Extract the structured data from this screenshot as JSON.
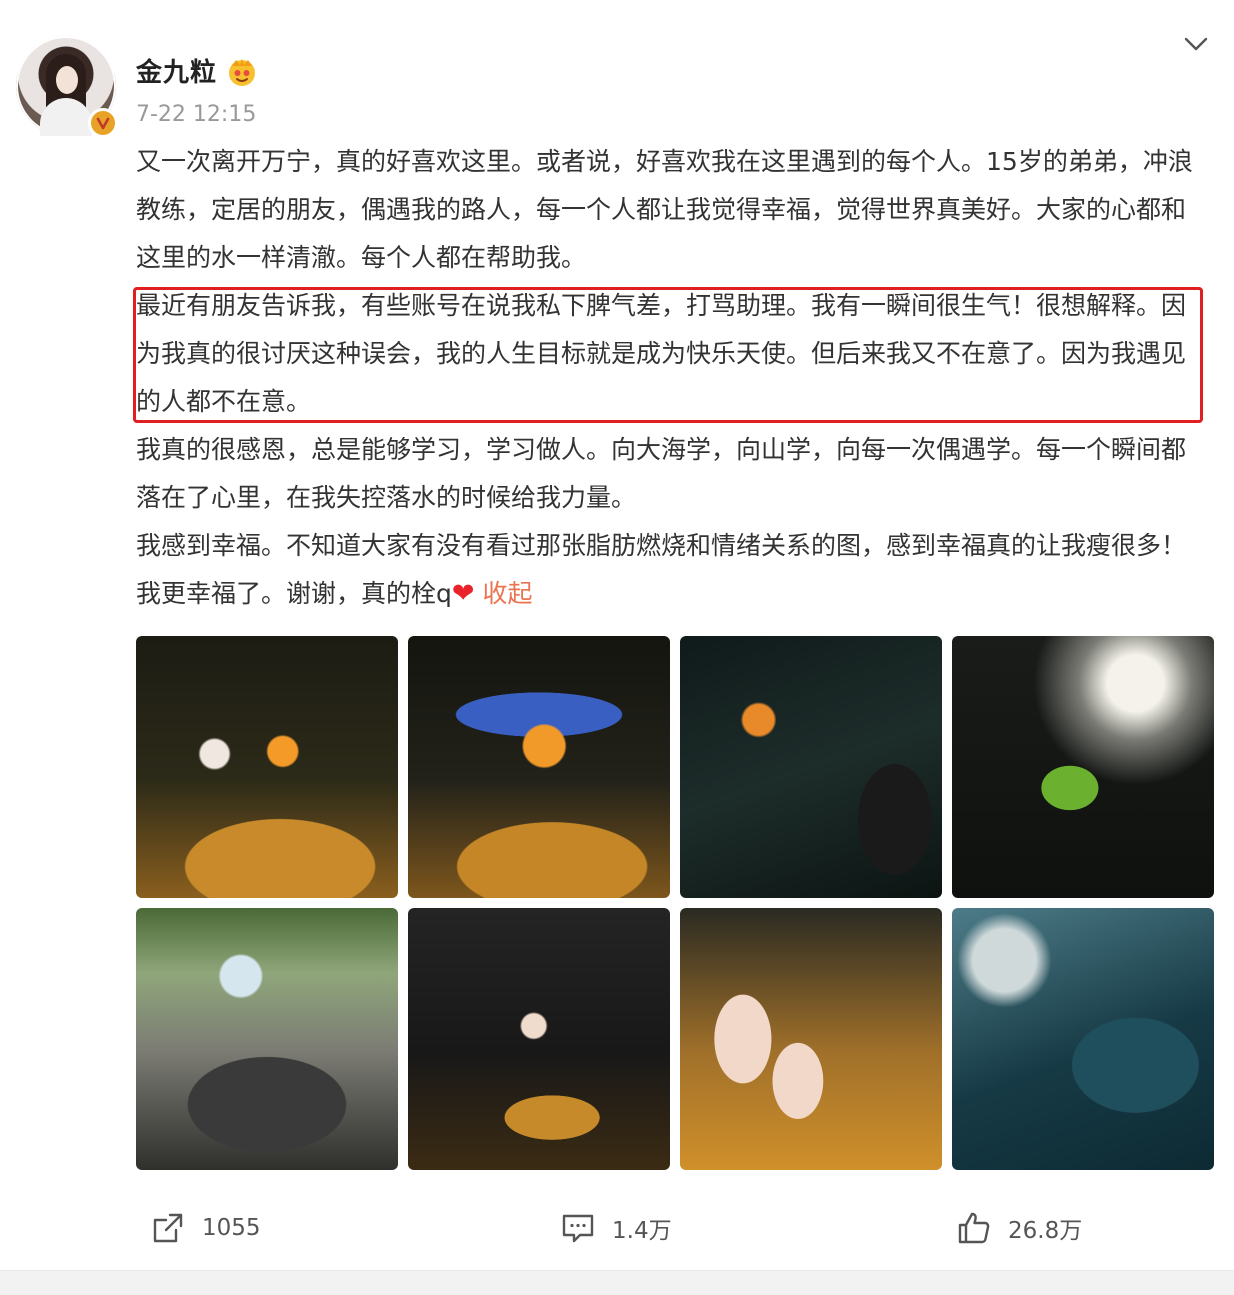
{
  "post": {
    "username": "金九粒",
    "timestamp": "7-22 12:15",
    "paragraphs": {
      "p1": "又一次离开万宁，真的好喜欢这里。或者说，好喜欢我在这里遇到的每个人。15岁的弟弟，冲浪教练，定居的朋友，偶遇我的路人，每一个人都让我觉得幸福，觉得世界真美好。大家的心都和这里的水一样清澈。每个人都在帮助我。",
      "p2": "最近有朋友告诉我，有些账号在说我私下脾气差，打骂助理。我有一瞬间很生气！很想解释。因为我真的很讨厌这种误会，我的人生目标就是成为快乐天使。但后来我又不在意了。因为我遇见的人都不在意。",
      "p3": "我真的很感恩，总是能够学习，学习做人。向大海学，向山学，向每一次偶遇学。每一个瞬间都落在了心里，在我失控落水的时候给我力量。",
      "p4": "我感到幸福。不知道大家有没有看过那张脂肪燃烧和情绪关系的图，感到幸福真的让我瘦很多！我更幸福了。谢谢，真的栓q"
    },
    "heart_glyph": "❤",
    "collapse_label": "收起"
  },
  "actions": {
    "repost_count": "1055",
    "comment_count": "1.4万",
    "like_count": "26.8万"
  },
  "colors": {
    "link": "#eb7350",
    "highlight_box": "#e02020",
    "verified_badge": "#e8a327",
    "heart": "#e8232b"
  },
  "icons": [
    "chevron-down-icon",
    "verified-icon",
    "member-icon",
    "repost-icon",
    "comment-icon",
    "like-icon"
  ]
}
